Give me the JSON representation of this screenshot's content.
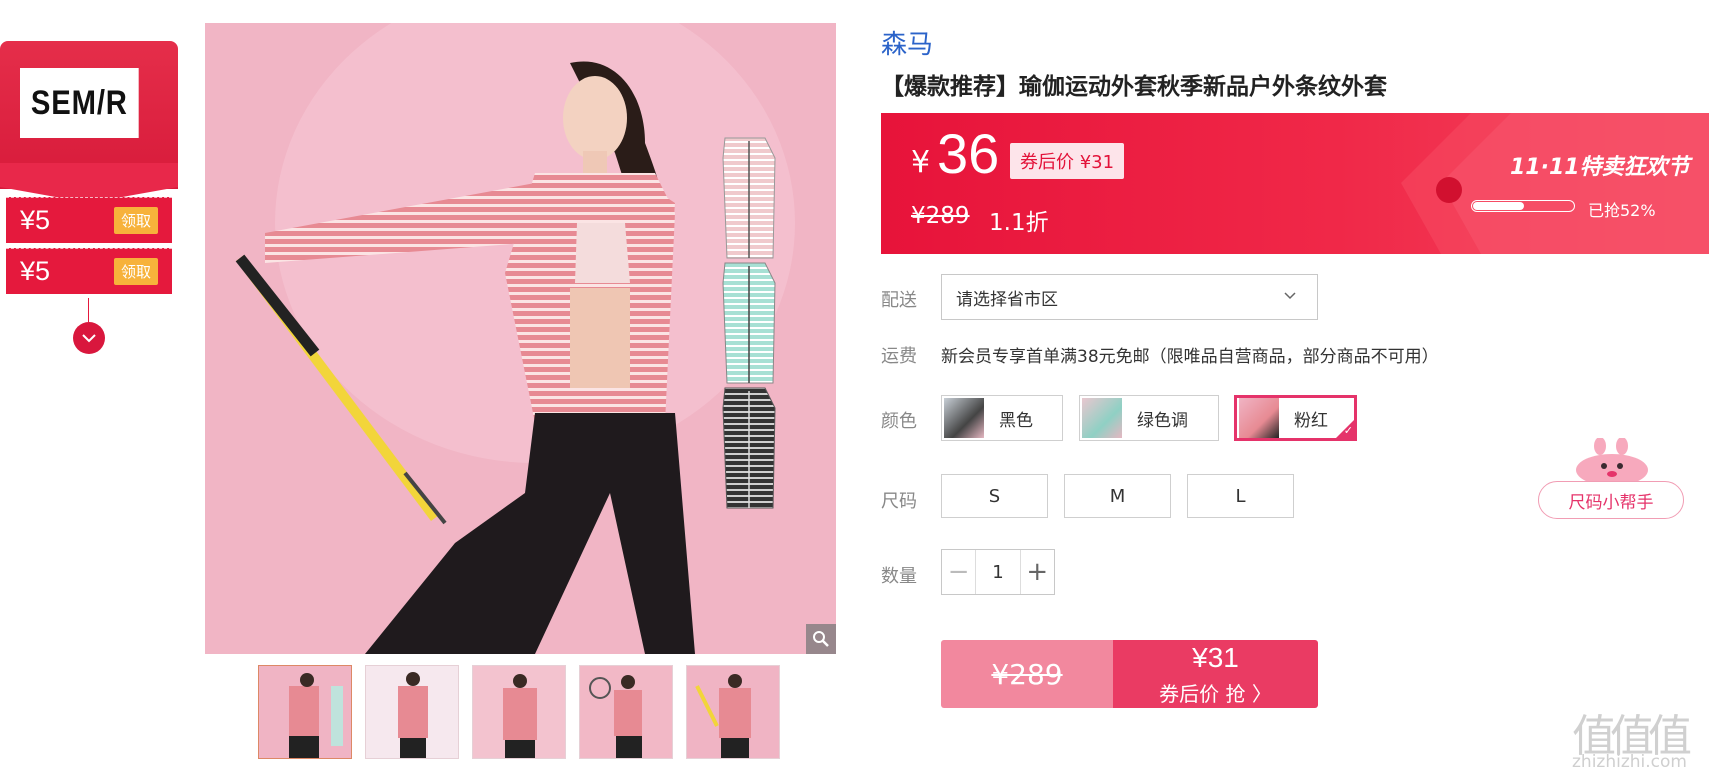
{
  "coupon_panel": {
    "brand_logo": "SEM/R",
    "coupons": [
      {
        "amount": "¥5",
        "action": "领取"
      },
      {
        "amount": "¥5",
        "action": "领取"
      }
    ],
    "expand_icon": "chevron-down-icon"
  },
  "gallery": {
    "zoom_icon": "magnifier-icon",
    "thumb_count": 5
  },
  "product": {
    "brand": "森马",
    "title": "【爆款推荐】瑜伽运动外套秋季新品户外条纹外套"
  },
  "price_banner": {
    "currency": "¥",
    "price": "36",
    "after_coupon": "券后价 ¥31",
    "original": "¥289",
    "discount": "1.1折",
    "festival": "11·11特卖狂欢节",
    "sold_percent": 52,
    "sold_text": "已抢52%",
    "colors": {
      "start": "#e7133a",
      "end": "#f4465e"
    }
  },
  "delivery": {
    "label": "配送",
    "placeholder": "请选择省市区"
  },
  "freight": {
    "label": "运费",
    "text": "新会员专享首单满38元免邮（限唯品自营商品，部分商品不可用）"
  },
  "colors": {
    "label": "颜色",
    "options": [
      {
        "name": "黑色",
        "selected": false
      },
      {
        "name": "绿色调",
        "selected": false
      },
      {
        "name": "粉红",
        "selected": true
      }
    ]
  },
  "sizes": {
    "label": "尺码",
    "options": [
      "S",
      "M",
      "L"
    ]
  },
  "quantity": {
    "label": "数量",
    "value": "1",
    "minus": "−",
    "plus": "+"
  },
  "buy": {
    "original": "¥289",
    "price": "¥31",
    "cta": "券后价 抢 〉"
  },
  "size_helper": {
    "label": "尺码小帮手"
  },
  "watermark": {
    "logo": "值值值",
    "site": "zhizhizhi.com"
  },
  "accent_color": "#e5336a"
}
